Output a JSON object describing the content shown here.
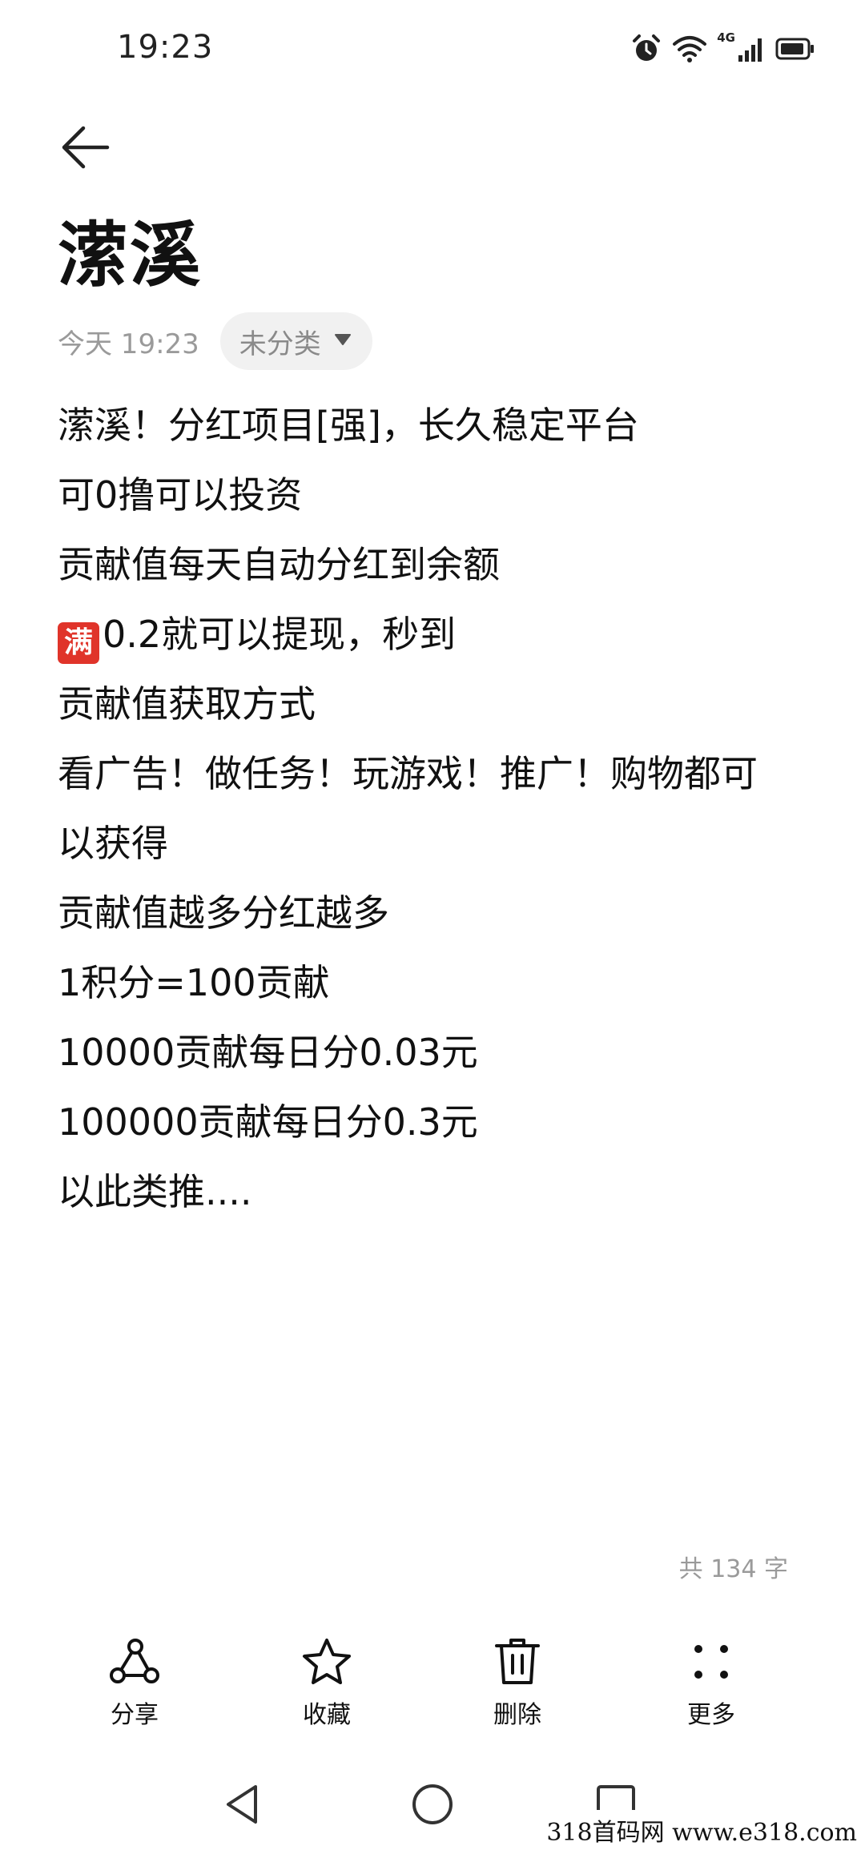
{
  "status_bar": {
    "time": "19:23",
    "network": "4G",
    "icons": [
      "alarm-icon",
      "wifi-icon",
      "cellular-signal-icon",
      "battery-icon"
    ]
  },
  "header": {
    "back_icon": "arrow-left-icon"
  },
  "note": {
    "title": "潆溪",
    "date": "今天 19:23",
    "category": "未分类",
    "lines": [
      "潆溪！分红项目[强]，长久稳定平台",
      "可0撸可以投资",
      "贡献值每天自动分红到余额",
      "0.2就可以提现，秒到",
      "贡献值获取方式",
      "看广告！做任务！玩游戏！推广！购物都可",
      "以获得",
      "贡献值越多分红越多",
      "1积分=100贡献",
      "10000贡献每日分0.03元",
      "100000贡献每日分0.3元",
      "以此类推...."
    ],
    "emoji_badge": "满",
    "word_count": "共 134 字"
  },
  "toolbar": {
    "share": "分享",
    "favorite": "收藏",
    "delete": "删除",
    "more": "更多"
  },
  "watermark": "318首码网   www.e318.com",
  "colors": {
    "text": "#111111",
    "muted": "#9a9a9a",
    "chip_bg": "#f1f1f1",
    "emoji_red": "#e0342a"
  }
}
